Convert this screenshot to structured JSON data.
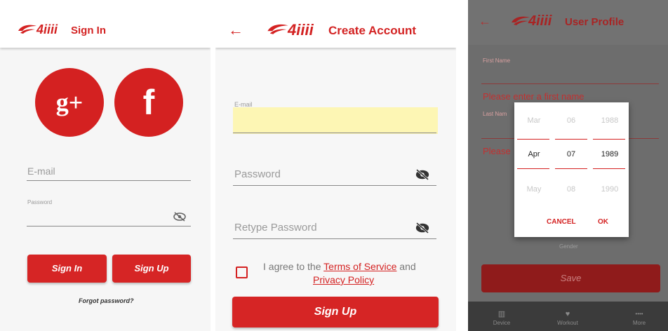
{
  "brand": {
    "logo_text": "4iiii",
    "accent": "#d42121"
  },
  "signin": {
    "title": "Sign In",
    "email_placeholder": "E-mail",
    "password_label": "Password",
    "signin_button": "Sign In",
    "signup_button": "Sign Up",
    "forgot": "Forgot password?",
    "google_label": "g+",
    "facebook_label": "f"
  },
  "create": {
    "title": "Create Account",
    "email_label": "E-mail",
    "password_placeholder": "Password",
    "retype_placeholder": "Retype Password",
    "agree_prefix": "I agree to the",
    "terms": "Terms of Service",
    "and": "and",
    "privacy": "Privacy Policy",
    "signup_button": "Sign Up"
  },
  "profile": {
    "title": "User Profile",
    "first_name_label": "First Name",
    "first_name_placeholder": "Please enter a first name",
    "last_name_label": "Last Nam",
    "last_name_placeholder": "Please",
    "gender_label": "Gender",
    "save_button": "Save",
    "date_picker": {
      "months": [
        "Mar",
        "Apr",
        "May"
      ],
      "days": [
        "06",
        "07",
        "08"
      ],
      "years": [
        "1988",
        "1989",
        "1990"
      ],
      "cancel": "CANCEL",
      "ok": "OK"
    },
    "nav": [
      {
        "label": "Device",
        "icon": "device-icon",
        "glyph": "▥"
      },
      {
        "label": "Workout",
        "icon": "heart-icon",
        "glyph": "♥"
      },
      {
        "label": "More",
        "icon": "more-icon",
        "glyph": "••••"
      }
    ]
  }
}
